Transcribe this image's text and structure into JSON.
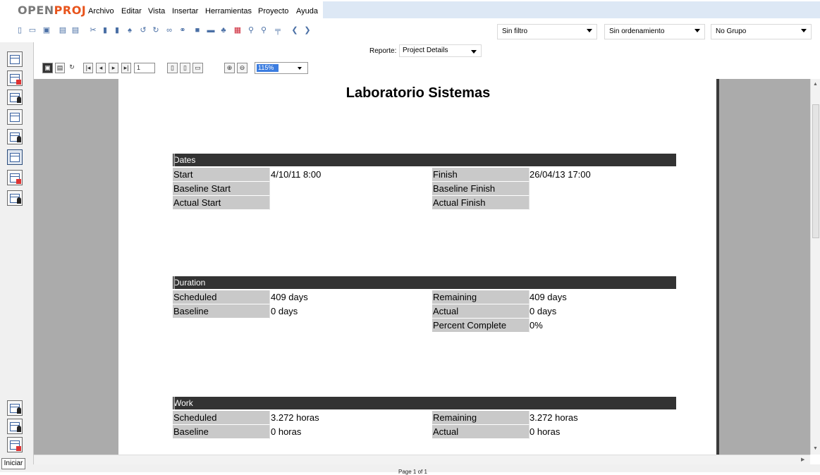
{
  "app": {
    "logo_part1": "OPEN",
    "logo_part2": "PROJ",
    "brand_color": "#e8541c"
  },
  "menu": [
    "Archivo",
    "Editar",
    "Vista",
    "Insertar",
    "Herramientas",
    "Proyecto",
    "Ayuda"
  ],
  "toolbar": {
    "filter": "Sin filtro",
    "sort": "Sin ordenamiento",
    "group": "No Grupo",
    "icons": [
      "new-icon",
      "open-icon",
      "save-icon",
      "print-icon",
      "print-preview-icon",
      "cut-icon",
      "copy-icon",
      "paste-icon",
      "find-icon",
      "undo-icon",
      "redo-icon",
      "link-icon",
      "unlink-icon",
      "task-info-icon",
      "notes-icon",
      "resource-icon",
      "calendar-icon",
      "zoom-in-icon",
      "zoom-out-icon",
      "filter-icon",
      "scroll-left-icon",
      "scroll-right-icon"
    ]
  },
  "report": {
    "label": "Reporte:",
    "selected": "Project Details",
    "page_field": "1",
    "zoom": "115%"
  },
  "page": {
    "title": "Laboratorio Sistemas",
    "sections": {
      "dates": {
        "header": "Dates",
        "start_label": "Start",
        "start_value": "4/10/11 8:00",
        "finish_label": "Finish",
        "finish_value": "26/04/13 17:00",
        "baseline_start_label": "Baseline Start",
        "baseline_finish_label": "Baseline Finish",
        "actual_start_label": "Actual Start",
        "actual_finish_label": "Actual Finish"
      },
      "duration": {
        "header": "Duration",
        "scheduled_label": "Scheduled",
        "scheduled_value": "409 days",
        "remaining_label": "Remaining",
        "remaining_value": "409 days",
        "baseline_label": "Baseline",
        "baseline_value": "0 days",
        "actual_label": "Actual",
        "actual_value": "0 days",
        "percent_label": "Percent Complete",
        "percent_value": "0%"
      },
      "work": {
        "header": "Work",
        "scheduled_label": "Scheduled",
        "scheduled_value": "3.272 horas",
        "remaining_label": "Remaining",
        "remaining_value": "3.272 horas",
        "baseline_label": "Baseline",
        "baseline_value": "0 horas",
        "actual_label": "Actual",
        "actual_value": "0 horas"
      }
    }
  },
  "status": {
    "page_indicator": "Page 1 of 1",
    "tooltip": "Iniciar"
  }
}
